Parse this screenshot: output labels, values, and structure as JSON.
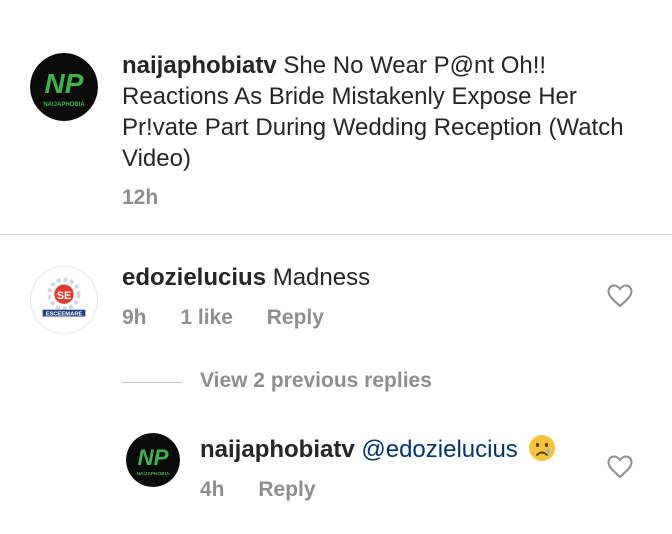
{
  "caption": {
    "username": "naijaphobiatv",
    "text": "She No Wear P@nt Oh!! Reactions As Bride Mistakenly Expose Her Pr!vate Part During Wedding Reception (Watch Video)",
    "time": "12h",
    "avatar_text": "NAIJAPHOBIA"
  },
  "comments": [
    {
      "username": "edozielucius",
      "text": "Madness",
      "time": "9h",
      "likes": "1 like",
      "reply_label": "Reply",
      "avatar_text": "ESCEEMARE"
    }
  ],
  "view_replies_label": "View 2 previous replies",
  "replies": [
    {
      "username": "naijaphobiatv",
      "mention": "@edozielucius",
      "emoji": "crying-face",
      "time": "4h",
      "reply_label": "Reply",
      "avatar_text": "NAIJAPHOBIA"
    }
  ],
  "colors": {
    "text": "#262626",
    "meta": "#8e8e8e",
    "mention": "#00376b",
    "logo_green": "#39b54a"
  }
}
